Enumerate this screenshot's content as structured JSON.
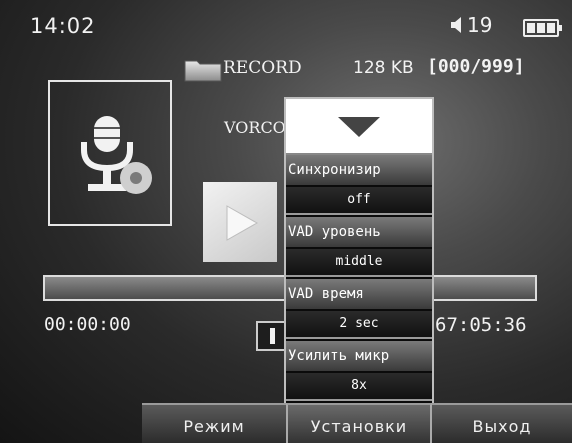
{
  "status": {
    "time": "14:02",
    "volume": "19",
    "volume_icon": "speaker-icon",
    "battery_icon": "battery-icon",
    "battery_level": 1.0
  },
  "file": {
    "folder_icon": "folder-icon",
    "folder": "RECORD",
    "size": "128 KB",
    "counter": "[000/999]"
  },
  "recorder": {
    "mode_label": "VORCO",
    "mic_icon": "microphone-icon",
    "play_icon": "play-icon",
    "elapsed": "00:00:00",
    "total": "67:05:36",
    "progress": 0
  },
  "popup": {
    "arrow_icon": "triangle-down-icon",
    "options": [
      {
        "label": "Синхронизир",
        "value": "off"
      },
      {
        "label": "VAD уровень",
        "value": "middle"
      },
      {
        "label": "VAD время",
        "value": "2 sec"
      },
      {
        "label": "Усилить микр",
        "value": "8x"
      }
    ]
  },
  "softkeys": {
    "mode": "Режим",
    "settings": "Установки",
    "exit": "Выход"
  },
  "colors": {
    "text": "#f2f2f2",
    "popup_bg": "#0b0b0b",
    "popup_head": "#ffffff"
  }
}
